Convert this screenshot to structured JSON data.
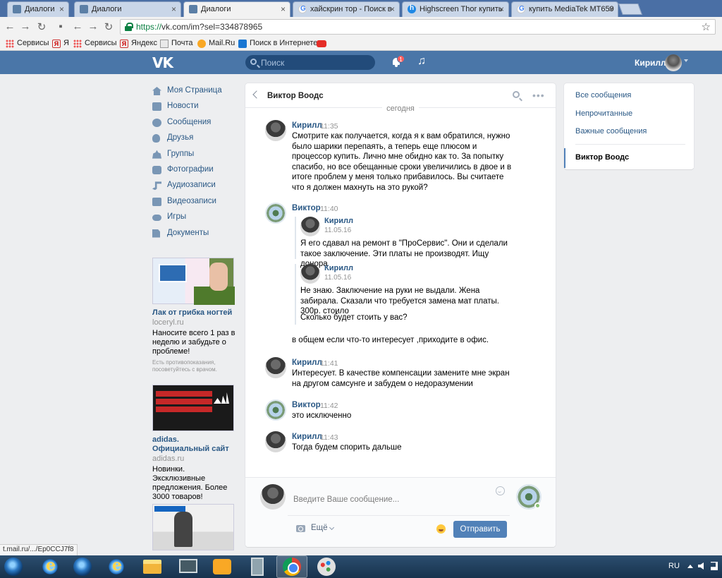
{
  "browser": {
    "tabs": [
      {
        "title": "Диалоги",
        "icon": "vk-favicon-icon",
        "active": false
      },
      {
        "title": "Диалоги",
        "icon": "vk-favicon-icon",
        "active": false
      },
      {
        "title": "Диалоги",
        "icon": "vk-favicon-icon",
        "active": true
      },
      {
        "title": "хайскрин тор - Поиск в",
        "icon": "google-favicon-icon",
        "active": false
      },
      {
        "title": "Highscreen Thor купить",
        "icon": "highscreen-favicon-icon",
        "active": false
      },
      {
        "title": "купить MediaTek MT659",
        "icon": "google-favicon-icon",
        "active": false
      }
    ],
    "close_glyph": "×",
    "url_proto": "https://",
    "url_rest": "vk.com/im?sel=334878965",
    "bookmarks": [
      {
        "label": "Сервисы",
        "icon": "apps-icon"
      },
      {
        "label": "Я",
        "icon": "yandex-icon"
      },
      {
        "label": "Сервисы",
        "icon": "apps-icon"
      },
      {
        "label": "Яндекс",
        "icon": "yandex-icon"
      },
      {
        "label": "Почта",
        "icon": "mail-icon"
      },
      {
        "label": "Mail.Ru",
        "icon": "mailru-icon"
      },
      {
        "label": "Поиск в Интернете",
        "icon": "search-engine-icon"
      },
      {
        "label": "",
        "icon": "youtube-icon"
      }
    ],
    "status_url": "t.mail.ru/.../Ep0CCJ7f8"
  },
  "header": {
    "logo": "VK",
    "search_placeholder": "Поиск",
    "notification_count": "1",
    "user_name": "Кирилл"
  },
  "left_menu": {
    "items": [
      {
        "label": "Моя Страница",
        "icon": "home-icon"
      },
      {
        "label": "Новости",
        "icon": "news-icon"
      },
      {
        "label": "Сообщения",
        "icon": "messages-icon"
      },
      {
        "label": "Друзья",
        "icon": "friends-icon"
      },
      {
        "label": "Группы",
        "icon": "groups-icon"
      },
      {
        "label": "Фотографии",
        "icon": "photos-icon"
      },
      {
        "label": "Аудиозаписи",
        "icon": "audio-icon"
      },
      {
        "label": "Видеозаписи",
        "icon": "video-icon"
      },
      {
        "label": "Игры",
        "icon": "games-icon"
      },
      {
        "label": "Документы",
        "icon": "documents-icon"
      }
    ]
  },
  "ads": [
    {
      "title": "Лак от грибка ногтей",
      "domain": "loceryl.ru",
      "text": "Наносите всего 1 раз в неделю и забудьте о проблеме!",
      "note": "Есть противопоказания, посоветуйтесь с врачом."
    },
    {
      "title": "adidas. Официальный сайт",
      "domain": "adidas.ru",
      "text": "Новинки. Эксклюзивные предложения. Более 3000 товаров!",
      "note": ""
    }
  ],
  "chat": {
    "peer_name": "Виктор Воодс",
    "day_divider": "сегодня",
    "messages": [
      {
        "author": "Кирилл",
        "time": "11:35",
        "text": "Смотрите как получается, когда я к вам обратился, нужно было шарики перепаять, а теперь еще плюсом и процессор купить. Лично мне обидно как то. За попытку спасибо, но все обещанные сроки увеличились в двое и в итоге проблем у меня только прибавилось. Вы считаете что я должен махнуть на это рукой?"
      },
      {
        "author": "Виктор",
        "time": "11:40",
        "forwarded": [
          {
            "author": "Кирилл",
            "date": "11.05.16",
            "text": "Я его сдавал на ремонт в \"ПроСервис\". Они и сделали такое заключение. Эти платы не производят. Ищу донора"
          },
          {
            "author": "Кирилл",
            "date": "11.05.16",
            "text": "Не знаю. Заключение на руки не выдали. Жена забирала. Сказали что требуется замена мат платы. 300р. стоило",
            "extra": "Сколько будет стоить у вас?"
          }
        ],
        "text": "в общем если что-то интересует ,приходите в офис."
      },
      {
        "author": "Кирилл",
        "time": "11:41",
        "text": "Интересует. В качестве компенсации замените мне экран на другом самсунге и забудем о недоразумении"
      },
      {
        "author": "Виктор",
        "time": "11:42",
        "text": "это исключенно"
      },
      {
        "author": "Кирилл",
        "time": "11:43",
        "text": "Тогда будем спорить дальше"
      }
    ],
    "composer": {
      "placeholder": "Введите Ваше сообщение...",
      "more_label": "Ещё",
      "send_label": "Отправить"
    }
  },
  "right_nav": {
    "items": [
      "Все сообщения",
      "Непрочитанные",
      "Важные сообщения"
    ],
    "active": "Виктор Воодс"
  },
  "taskbar": {
    "lang": "RU"
  }
}
